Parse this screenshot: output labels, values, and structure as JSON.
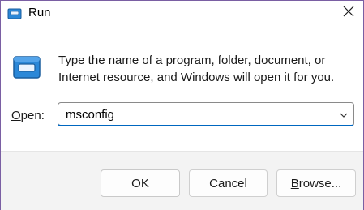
{
  "window": {
    "title": "Run"
  },
  "dialog": {
    "description": "Type the name of a program, folder, document, or Internet resource, and Windows will open it for you.",
    "open_label_mnemonic": "O",
    "open_label_rest": "pen:",
    "open_value": "msconfig"
  },
  "buttons": {
    "ok": "OK",
    "cancel": "Cancel",
    "browse_mnemonic": "B",
    "browse_rest": "rowse..."
  },
  "icons": {
    "title_icon": "run-icon",
    "big_icon": "run-icon",
    "close": "close-icon",
    "dropdown": "chevron-down-icon"
  },
  "colors": {
    "accent": "#0067c0",
    "window_border": "#7a5fa3",
    "footer_bg": "#f3f3f3"
  }
}
